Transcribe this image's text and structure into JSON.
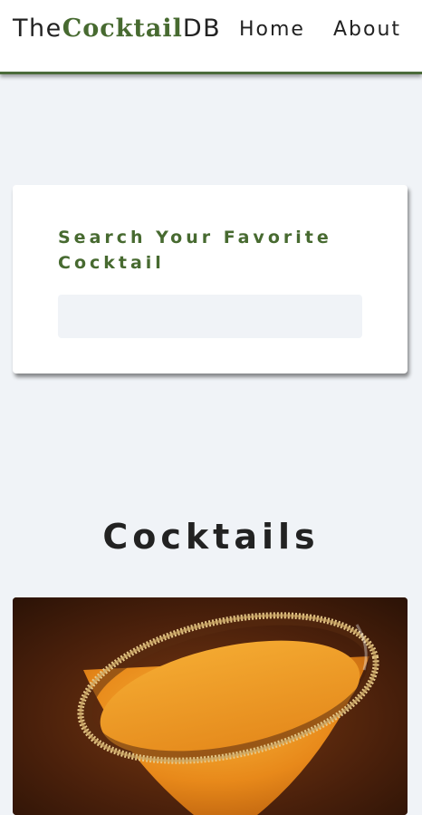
{
  "navbar": {
    "logo": {
      "prefix": "The",
      "accent": "Cocktail",
      "suffix": "DB"
    },
    "links": [
      {
        "label": "Home"
      },
      {
        "label": "About"
      }
    ]
  },
  "search": {
    "label": "Search Your Favorite Cocktail",
    "value": "",
    "placeholder": ""
  },
  "section": {
    "title": "Cocktails"
  },
  "cocktails": [
    {
      "image": "martini-glass-orange-cocktail-sugar-rim"
    }
  ],
  "colors": {
    "accent": "#476a30",
    "background": "#f0f3f7",
    "card": "#ffffff"
  }
}
